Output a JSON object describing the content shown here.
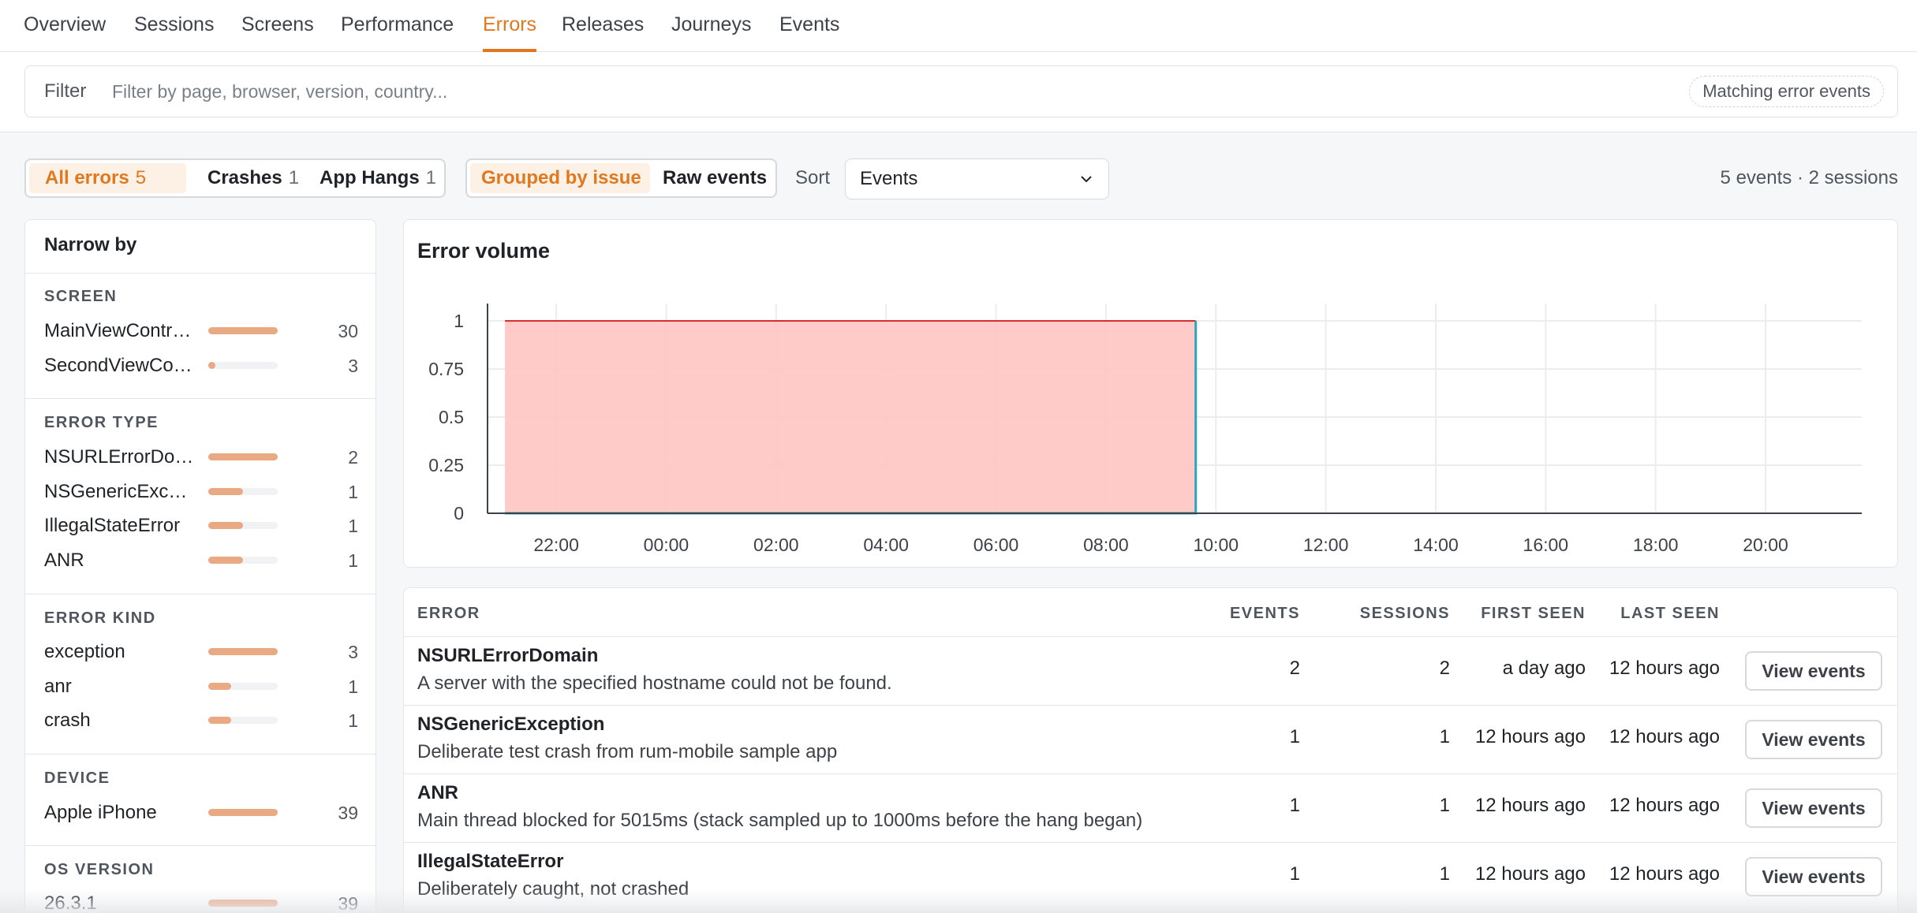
{
  "nav": {
    "tabs": [
      {
        "label": "Overview"
      },
      {
        "label": "Sessions"
      },
      {
        "label": "Screens"
      },
      {
        "label": "Performance"
      },
      {
        "label": "Errors"
      },
      {
        "label": "Releases"
      },
      {
        "label": "Journeys"
      },
      {
        "label": "Events"
      }
    ],
    "active_tab": "Errors"
  },
  "filter": {
    "label": "Filter",
    "placeholder": "Filter by page, browser, version, country...",
    "value": "",
    "chip": "Matching error events"
  },
  "toolbar": {
    "error_filters": [
      {
        "label": "All errors",
        "count": "5",
        "active": true
      },
      {
        "label": "Crashes",
        "count": "1",
        "active": false
      },
      {
        "label": "App Hangs",
        "count": "1",
        "active": false
      }
    ],
    "grouping": [
      {
        "label": "Grouped by issue",
        "active": true
      },
      {
        "label": "Raw events",
        "active": false
      }
    ],
    "sort_label": "Sort",
    "sort_value": "Events",
    "summary": "5 events · 2 sessions"
  },
  "narrow": {
    "title": "Narrow by",
    "sections": [
      {
        "title": "SCREEN",
        "items": [
          {
            "label": "MainViewController",
            "count": "30",
            "fraction": 1.0
          },
          {
            "label": "SecondViewController",
            "count": "3",
            "fraction": 0.1
          }
        ]
      },
      {
        "title": "ERROR TYPE",
        "items": [
          {
            "label": "NSURLErrorDomain",
            "count": "2",
            "fraction": 1.0
          },
          {
            "label": "NSGenericException",
            "count": "1",
            "fraction": 0.5
          },
          {
            "label": "IllegalStateError",
            "count": "1",
            "fraction": 0.5
          },
          {
            "label": "ANR",
            "count": "1",
            "fraction": 0.5
          }
        ]
      },
      {
        "title": "ERROR KIND",
        "items": [
          {
            "label": "exception",
            "count": "3",
            "fraction": 1.0
          },
          {
            "label": "anr",
            "count": "1",
            "fraction": 0.33
          },
          {
            "label": "crash",
            "count": "1",
            "fraction": 0.33
          }
        ]
      },
      {
        "title": "DEVICE",
        "items": [
          {
            "label": "Apple iPhone",
            "count": "39",
            "fraction": 1.0
          }
        ]
      },
      {
        "title": "OS VERSION",
        "items": [
          {
            "label": "26.3.1",
            "count": "39",
            "fraction": 1.0
          }
        ]
      }
    ]
  },
  "chart": {
    "title": "Error volume"
  },
  "chart_data": {
    "type": "area",
    "title": "Error volume",
    "x_ticks": [
      "22:00",
      "00:00",
      "02:00",
      "04:00",
      "06:00",
      "08:00",
      "10:00",
      "12:00",
      "14:00",
      "16:00",
      "18:00",
      "20:00"
    ],
    "y_ticks": [
      "0",
      "0.25",
      "0.5",
      "0.75",
      "1"
    ],
    "ylim": [
      0,
      1
    ],
    "xlim_hours": [
      -3.25,
      21.75
    ],
    "grid": true,
    "series": [
      {
        "color": "#ffc8c6",
        "stroke": "#d32f2f",
        "points": [
          {
            "x": "21:04",
            "y": 1
          },
          {
            "x": "09:38",
            "y": 1
          }
        ]
      },
      {
        "color": "#2aa8b8",
        "points": [
          {
            "x": "21:04",
            "y": 0
          },
          {
            "x": "09:38",
            "y": 0
          },
          {
            "x": "09:38",
            "y": 1
          }
        ]
      }
    ]
  },
  "table": {
    "headers": {
      "error": "ERROR",
      "events": "EVENTS",
      "sessions": "SESSIONS",
      "first_seen": "FIRST SEEN",
      "last_seen": "LAST SEEN"
    },
    "button_label": "View events",
    "rows": [
      {
        "name": "NSURLErrorDomain",
        "message": "A server with the specified hostname could not be found.",
        "events": "2",
        "sessions": "2",
        "first_seen": "a day ago",
        "last_seen": "12 hours ago"
      },
      {
        "name": "NSGenericException",
        "message": "Deliberate test crash from rum-mobile sample app",
        "events": "1",
        "sessions": "1",
        "first_seen": "12 hours ago",
        "last_seen": "12 hours ago"
      },
      {
        "name": "ANR",
        "message": "Main thread blocked for 5015ms (stack sampled up to 1000ms before the hang began)",
        "events": "1",
        "sessions": "1",
        "first_seen": "12 hours ago",
        "last_seen": "12 hours ago"
      },
      {
        "name": "IllegalStateError",
        "message": "Deliberately caught, not crashed",
        "events": "1",
        "sessions": "1",
        "first_seen": "12 hours ago",
        "last_seen": "12 hours ago"
      }
    ]
  },
  "colors": {
    "accent": "#e0781f",
    "bar": "#e9a983",
    "area_fill": "#ffc8c6",
    "area_stroke": "#d32f2f",
    "line": "#2aa8b8"
  }
}
